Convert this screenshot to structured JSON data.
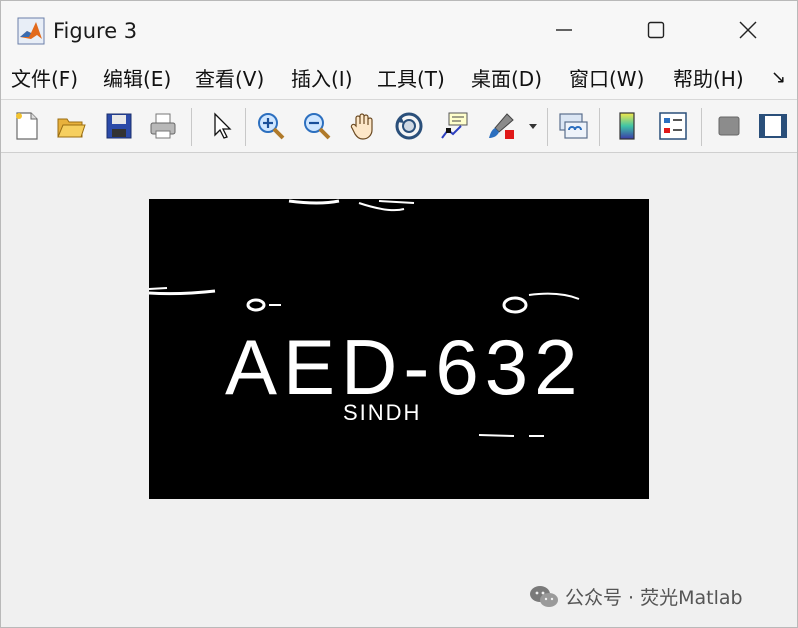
{
  "window": {
    "title": "Figure 3"
  },
  "menu": {
    "items": [
      {
        "label": "文件(F)"
      },
      {
        "label": "编辑(E)"
      },
      {
        "label": "查看(V)"
      },
      {
        "label": "插入(I)"
      },
      {
        "label": "工具(T)"
      },
      {
        "label": "桌面(D)"
      },
      {
        "label": "窗口(W)"
      },
      {
        "label": "帮助(H)"
      }
    ],
    "more_glyph": "↘"
  },
  "toolbar": {
    "icons": [
      "new-figure-icon",
      "open-file-icon",
      "save-icon",
      "print-icon",
      "select-pointer-icon",
      "zoom-in-icon",
      "zoom-out-icon",
      "pan-hand-icon",
      "rotate-3d-icon",
      "data-cursor-icon",
      "brush-icon",
      "link-plot-icon",
      "colorbar-icon",
      "legend-icon",
      "hide-plot-tools-icon",
      "show-plot-tools-icon"
    ]
  },
  "figure": {
    "plate_text": "AED-632",
    "plate_subtext": "SINDH"
  },
  "watermark": {
    "text": "公众号 · 荧光Matlab"
  },
  "colors": {
    "background": "#f0f0f0",
    "image_bg": "#000000",
    "image_fg": "#ffffff"
  }
}
